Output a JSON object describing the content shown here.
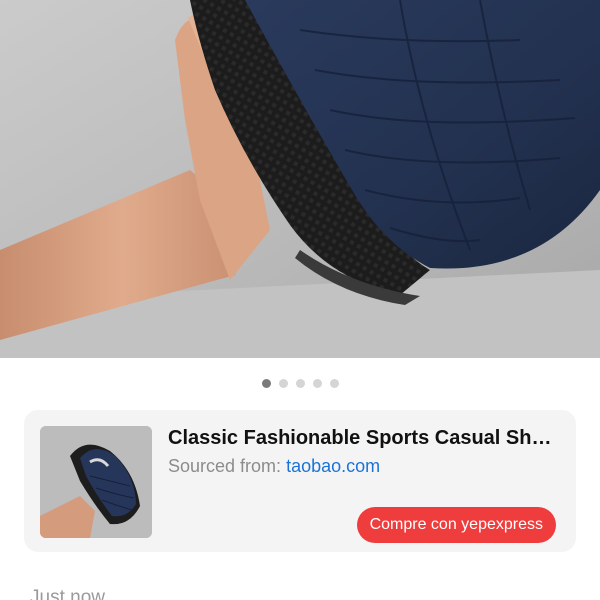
{
  "hero": {
    "image_icon": "product-photo-slipper-icon"
  },
  "gallery": {
    "total_images": 5,
    "active_index": 0
  },
  "product": {
    "title": "Classic Fashionable Sports Casual Shoes",
    "source_label": "Sourced from:",
    "source_site": "taobao.com",
    "buy_button_label": "Compre con yepexpress"
  },
  "message": {
    "timestamp": "Just now"
  },
  "colors": {
    "buy_button": "#ef3d3d",
    "link": "#1b73d8",
    "card_background": "#f4f4f5",
    "active_dot": "#7a7a7a",
    "inactive_dot": "#d5d5d5"
  }
}
